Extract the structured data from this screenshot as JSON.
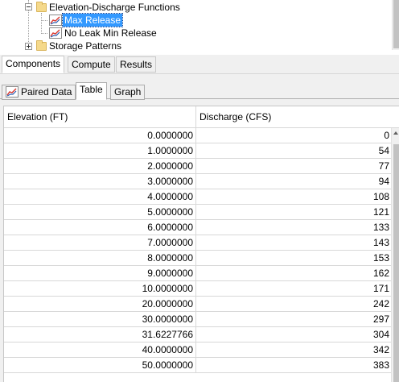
{
  "tree": {
    "items": [
      {
        "label": "Elevation-Discharge Functions",
        "icon": "folder-icon",
        "expanded": true
      },
      {
        "label": "Max Release",
        "icon": "paired-data-curve-icon",
        "selected": true
      },
      {
        "label": "No Leak Min Release",
        "icon": "paired-data-curve-icon",
        "selected": false
      },
      {
        "label": "Storage Patterns",
        "icon": "folder-icon",
        "expanded": false
      }
    ]
  },
  "main_tabs": [
    {
      "label": "Components",
      "active": true
    },
    {
      "label": "Compute",
      "active": false
    },
    {
      "label": "Results",
      "active": false
    }
  ],
  "sub_tabs": [
    {
      "label": "Paired Data",
      "icon": "paired-data-curve-icon",
      "active": false
    },
    {
      "label": "Table",
      "active": true
    },
    {
      "label": "Graph",
      "active": false
    }
  ],
  "table": {
    "headers": [
      "Elevation (FT)",
      "Discharge (CFS)"
    ],
    "rows": [
      [
        "0.0000000",
        "0"
      ],
      [
        "1.0000000",
        "54"
      ],
      [
        "2.0000000",
        "77"
      ],
      [
        "3.0000000",
        "94"
      ],
      [
        "4.0000000",
        "108"
      ],
      [
        "5.0000000",
        "121"
      ],
      [
        "6.0000000",
        "133"
      ],
      [
        "7.0000000",
        "143"
      ],
      [
        "8.0000000",
        "153"
      ],
      [
        "9.0000000",
        "162"
      ],
      [
        "10.0000000",
        "171"
      ],
      [
        "20.0000000",
        "242"
      ],
      [
        "30.0000000",
        "297"
      ],
      [
        "31.6227766",
        "304"
      ],
      [
        "40.0000000",
        "342"
      ],
      [
        "50.0000000",
        "383"
      ]
    ]
  },
  "colors": {
    "selection": "#3399ff",
    "curve_red": "#d9342b",
    "curve_blue": "#2a5db0",
    "folder": "#f5d98b"
  }
}
